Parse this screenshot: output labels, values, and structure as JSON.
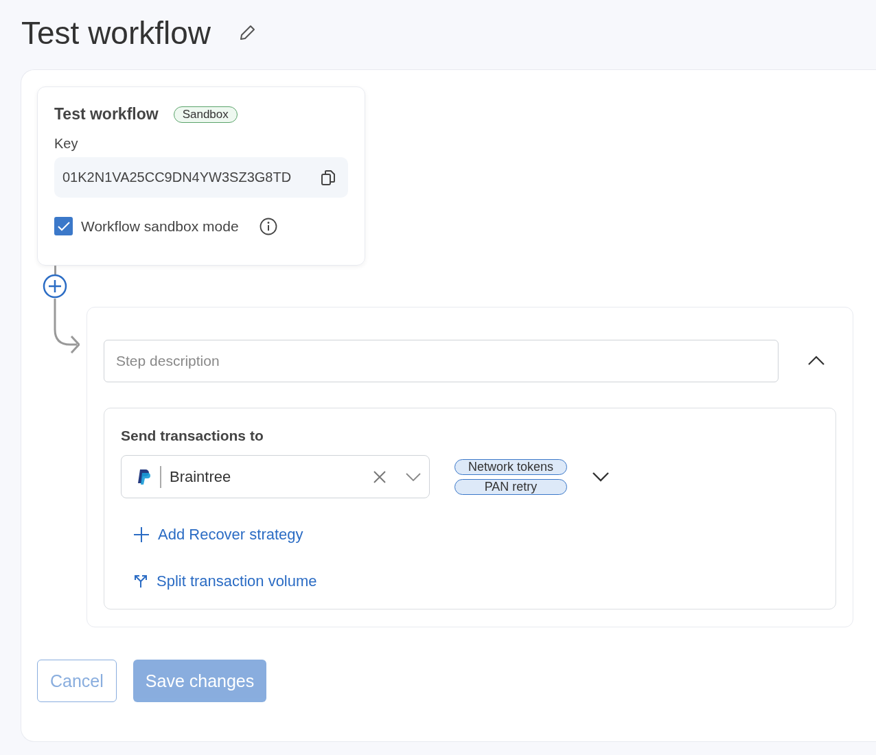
{
  "page_title": "Test workflow",
  "trigger": {
    "title": "Test workflow",
    "badge": "Sandbox",
    "key_label": "Key",
    "key_value": "01K2N1VA25CC9DN4YW3SZ3G8TD",
    "sandbox_mode": {
      "label": "Workflow sandbox mode",
      "checked": true
    }
  },
  "step": {
    "description_placeholder": "Step description",
    "expanded": true,
    "send_label": "Send transactions to",
    "processor": "Braintree",
    "tags": [
      {
        "label": "Network tokens"
      },
      {
        "label": "PAN retry"
      }
    ],
    "actions": [
      {
        "kind": "add",
        "label": "Add Recover strategy"
      },
      {
        "kind": "split",
        "label": "Split transaction volume"
      }
    ]
  },
  "buttons": [
    {
      "kind": "secondary",
      "label": "Cancel",
      "disabled": true
    },
    {
      "kind": "primary",
      "label": "Save changes",
      "disabled": true
    }
  ]
}
